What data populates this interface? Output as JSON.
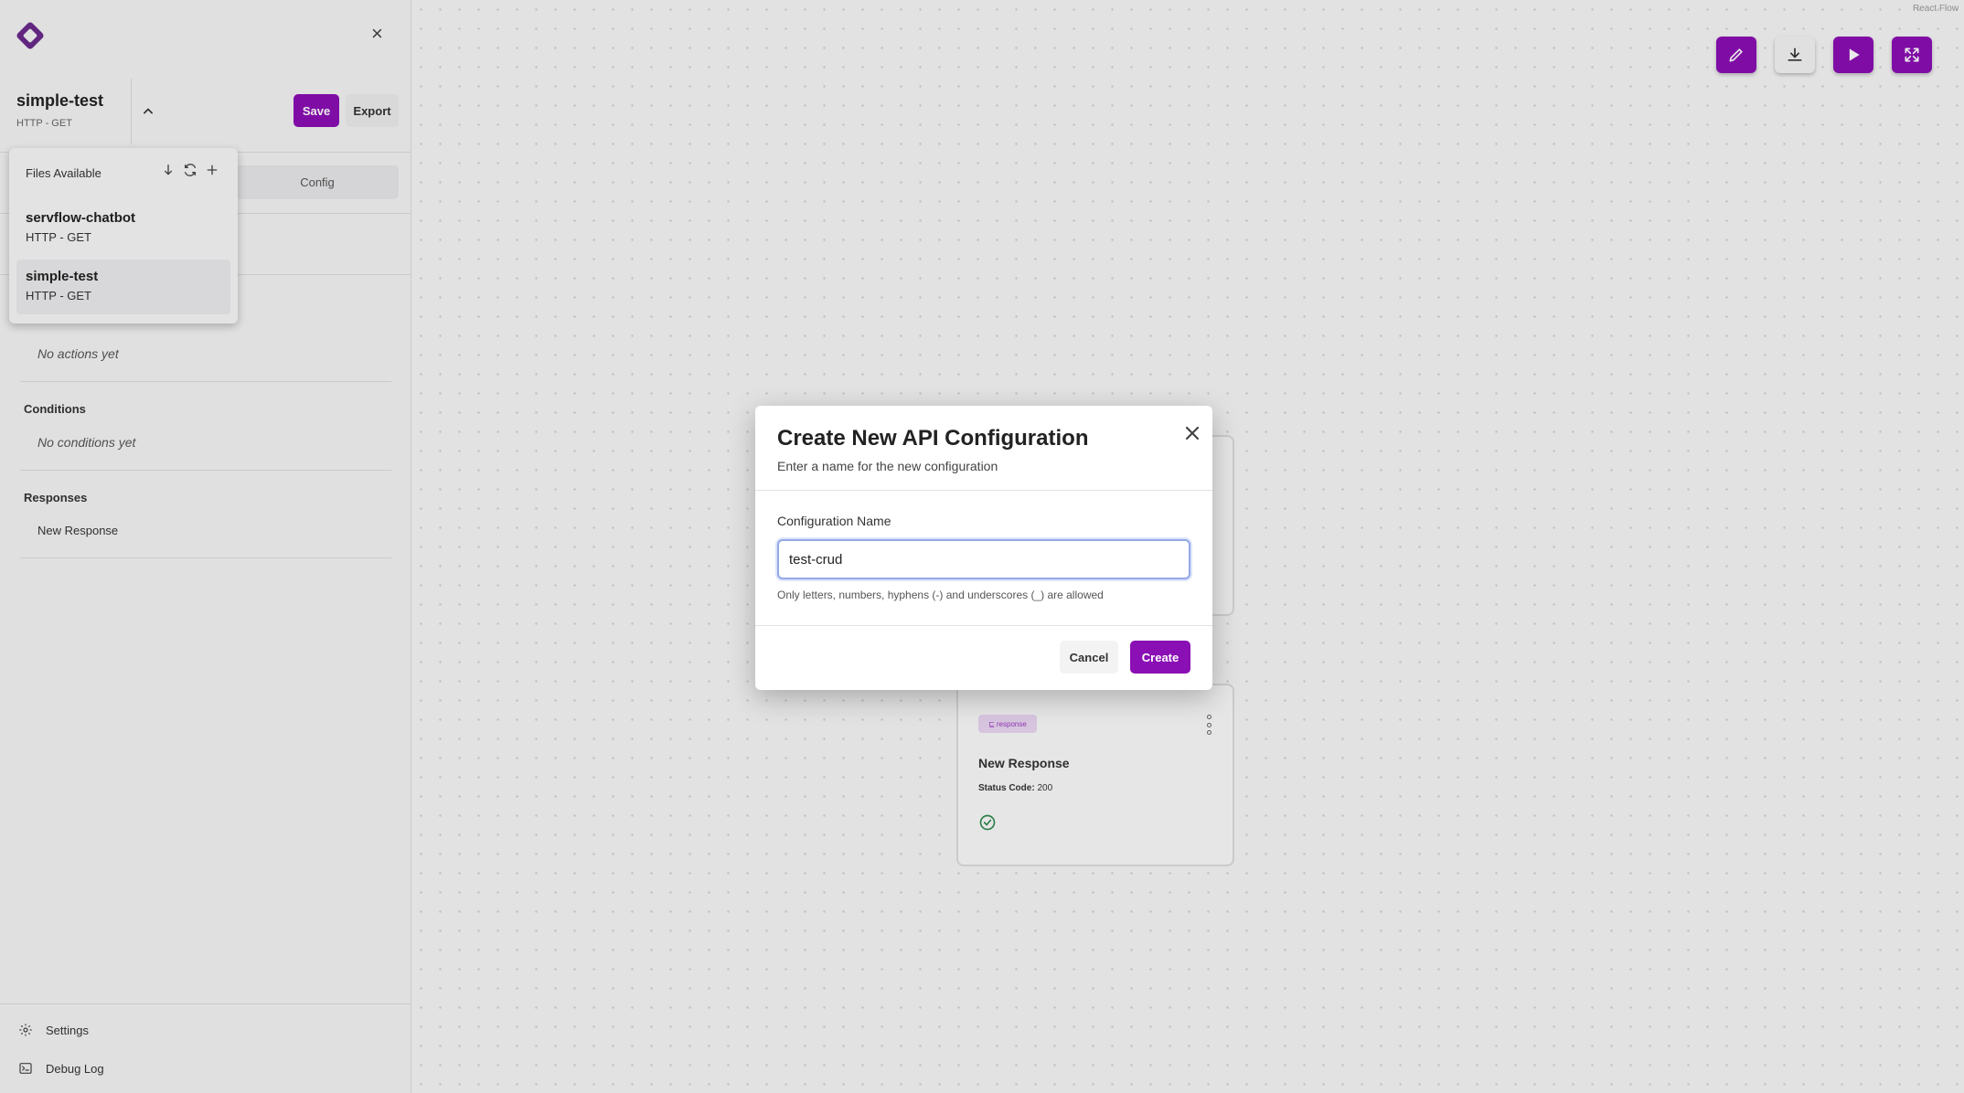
{
  "canvas": {
    "attribution": "React Flow",
    "response_node": {
      "badge": "response",
      "title": "New Response",
      "status_label": "Status Code:",
      "status_value": "200"
    }
  },
  "sidebar": {
    "file": {
      "name": "simple-test",
      "method": "HTTP - GET"
    },
    "save_label": "Save",
    "export_label": "Export",
    "tab_config": "Config",
    "sections": {
      "actions_empty": "No actions yet",
      "conditions_title": "Conditions",
      "conditions_empty": "No conditions yet",
      "responses_title": "Responses",
      "responses_items": [
        "New Response"
      ]
    },
    "footer": {
      "settings": "Settings",
      "debug_log": "Debug Log"
    }
  },
  "dropdown": {
    "title": "Files Available",
    "items": [
      {
        "name": "servflow-chatbot",
        "method": "HTTP - GET"
      },
      {
        "name": "simple-test",
        "method": "HTTP - GET"
      }
    ]
  },
  "modal": {
    "title": "Create New API Configuration",
    "subtitle": "Enter a name for the new configuration",
    "field_label": "Configuration Name",
    "field_value": "test-crud",
    "hint": "Only letters, numbers, hyphens (-) and underscores (_) are allowed",
    "cancel_label": "Cancel",
    "create_label": "Create"
  },
  "colors": {
    "accent": "#8a0fb4",
    "focus": "#93a8e6"
  },
  "icons": [
    "logo-icon",
    "close-icon",
    "chevron-up-icon",
    "download-icon",
    "refresh-icon",
    "plus-icon",
    "edit-icon",
    "play-icon",
    "fullscreen-icon",
    "gear-icon",
    "terminal-icon",
    "check-circle-icon",
    "kebab-icon"
  ]
}
